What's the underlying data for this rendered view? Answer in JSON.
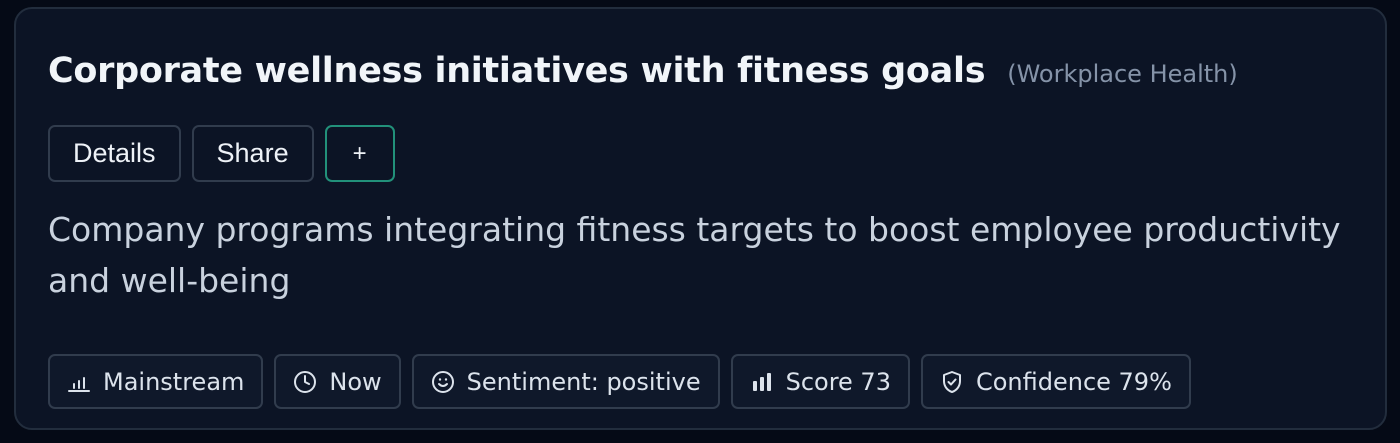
{
  "card": {
    "title": "Corporate wellness initiatives with fitness goals",
    "category": "(Workplace Health)",
    "description": "Company programs integrating fitness targets to boost employee productivity and well-being"
  },
  "actions": {
    "details_label": "Details",
    "share_label": "Share",
    "add_label": "+"
  },
  "chips": [
    {
      "icon": "chart-bars-icon",
      "label": "Mainstream"
    },
    {
      "icon": "clock-icon",
      "label": "Now"
    },
    {
      "icon": "smiley-icon",
      "label": "Sentiment: positive"
    },
    {
      "icon": "bar-chart-icon",
      "label": "Score 73"
    },
    {
      "icon": "shield-check-icon",
      "label": "Confidence 79%"
    }
  ],
  "colors": {
    "background": "#050a16",
    "card": "#0c1425",
    "accent_border": "#22917a",
    "title": "#f1f5f9",
    "muted": "#8593a8"
  }
}
